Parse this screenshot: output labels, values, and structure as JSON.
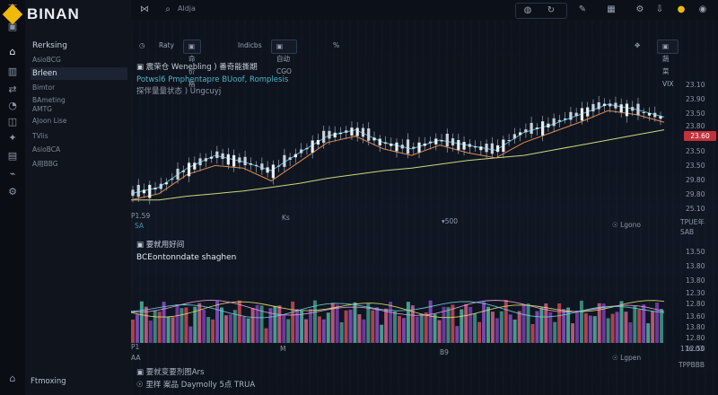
{
  "app": {
    "brand": "BINAN"
  },
  "sidebar": {
    "heading": "Rerksing",
    "items": [
      {
        "label": "AsioBCG"
      },
      {
        "label": "Brleen",
        "active": true
      },
      {
        "label": "Bimtor"
      },
      {
        "label": "BAmeting"
      },
      {
        "label": "AMTG"
      },
      {
        "label": "AJoon Lise"
      },
      {
        "label": "TViis"
      },
      {
        "label": "AsioBCA"
      },
      {
        "label": "A用BBG"
      }
    ],
    "footer": "Ftmoxing"
  },
  "topbar": {
    "search_placeholder": "Aldja"
  },
  "toolbar": {
    "interval": "Raty",
    "chip1": "▣ 命价格",
    "chip2": "Indicbs",
    "chip3": "▣ 自动CGO",
    "percent": "%",
    "right_chip": "▣ 蔬菜VIX"
  },
  "price_panel": {
    "legend_title": "▣ 震荣仓 Wenebling )   番奇能撕期",
    "legend_line2": "Potwsl6   Pmphentapre  BUoof, Romplesis",
    "legend_line3": "探伴量量状态 )  Ungcuyj",
    "y_ticks": [
      "23.10",
      "23.90",
      "23.50",
      "23.80",
      "23.60",
      "23.50",
      "23.50",
      "29.80",
      "29.80",
      "25.10"
    ],
    "current_price": "23.60",
    "x_labels": [
      "P1.59",
      "SA",
      "Ks",
      "▾500",
      "☉ Lgono",
      "TPUE年",
      "SAB"
    ]
  },
  "volume_panel": {
    "legend_title": "▣ 要就用好间",
    "subtitle": "BCEontonndate shaghen",
    "y_ticks": [
      "13.50",
      "13.80",
      "13.80",
      "12.30",
      "12.80",
      "13.60",
      "13.80",
      "12.80",
      "12.50"
    ],
    "x_labels": [
      "P1",
      "AA",
      "M",
      "B9",
      "☉ Lgpen",
      "116.03",
      "TPPBBB"
    ]
  },
  "bottom": {
    "line1": "▣ 要就变要剂图Ars",
    "line2": "☉ 里样 案品 Daymolly 5点  TRUA"
  },
  "chart_data": [
    {
      "type": "line",
      "title": "",
      "series": [
        {
          "values": [
            23.05,
            23.05,
            23.08,
            23.1,
            23.12,
            23.15,
            23.18,
            23.22,
            23.25,
            23.28,
            23.3,
            23.33,
            23.36,
            23.38,
            23.4,
            23.44,
            23.48,
            23.52,
            23.56,
            23.6
          ]
        },
        {
          "values": [
            23.05,
            23.1,
            23.25,
            23.32,
            23.3,
            23.2,
            23.35,
            23.5,
            23.55,
            23.45,
            23.4,
            23.48,
            23.42,
            23.38,
            23.5,
            23.58,
            23.66,
            23.75,
            23.72,
            23.66
          ]
        },
        {
          "values": [
            23.1,
            23.15,
            23.3,
            23.4,
            23.35,
            23.28,
            23.42,
            23.55,
            23.6,
            23.5,
            23.45,
            23.52,
            23.48,
            23.44,
            23.58,
            23.64,
            23.72,
            23.8,
            23.76,
            23.7
          ]
        }
      ]
    },
    {
      "type": "bar",
      "title": "",
      "values_count": 120
    }
  ]
}
